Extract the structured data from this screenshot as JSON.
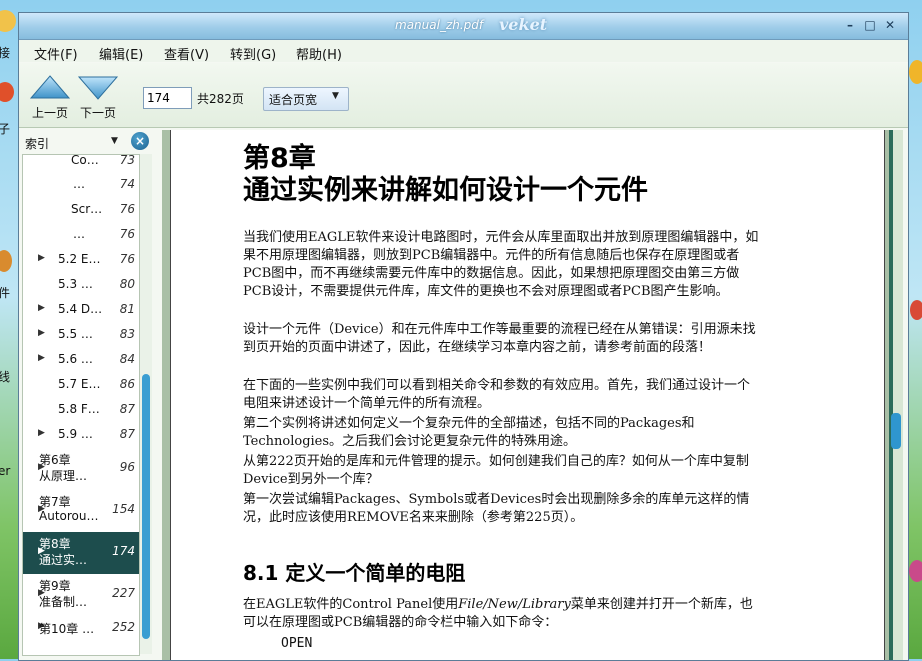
{
  "window": {
    "title": "manual_zh.pdf",
    "brand": "veket",
    "controls": [
      "–",
      "□",
      "✕"
    ]
  },
  "desktop": {
    "left_labels": [
      "接",
      "子",
      "件",
      "线",
      "er"
    ]
  },
  "menu": [
    {
      "label": "文件(F)"
    },
    {
      "label": "编辑(E)"
    },
    {
      "label": "查看(V)"
    },
    {
      "label": "转到(G)"
    },
    {
      "label": "帮助(H)"
    }
  ],
  "toolbar": {
    "prev_label": "上一页",
    "prev_icon": "triangle-up-icon",
    "next_label": "下一页",
    "next_icon": "triangle-down-icon",
    "page_value": "174",
    "total_label": "共282页",
    "zoom_value": "适合页宽"
  },
  "sidebar": {
    "mode": "索引",
    "close_icon": "close-icon",
    "items": [
      {
        "title": "Co…",
        "page": "73",
        "expander": false,
        "selected": false
      },
      {
        "title": "…",
        "page": "74",
        "expander": false,
        "selected": false
      },
      {
        "title": "Scr…",
        "page": "76",
        "expander": false,
        "selected": false
      },
      {
        "title": "…",
        "page": "76",
        "expander": false,
        "selected": false
      },
      {
        "title": "5.2 E…",
        "page": "76",
        "expander": true,
        "selected": false
      },
      {
        "title": "5.3 …",
        "page": "80",
        "expander": false,
        "selected": false
      },
      {
        "title": "5.4 D…",
        "page": "81",
        "expander": true,
        "selected": false
      },
      {
        "title": "5.5 …",
        "page": "83",
        "expander": true,
        "selected": false
      },
      {
        "title": "5.6 …",
        "page": "84",
        "expander": true,
        "selected": false
      },
      {
        "title": "5.7 E…",
        "page": "86",
        "expander": false,
        "selected": false
      },
      {
        "title": "5.8 F…",
        "page": "87",
        "expander": false,
        "selected": false
      },
      {
        "title": "5.9 …",
        "page": "87",
        "expander": true,
        "selected": false
      },
      {
        "title": "第6章",
        "title2": "从原理…",
        "page": "96",
        "expander": true,
        "selected": false
      },
      {
        "title": "第7章",
        "title2": "Autorou…",
        "page": "154",
        "expander": true,
        "selected": false
      },
      {
        "title": "第8章",
        "title2": "通过实…",
        "page": "174",
        "expander": true,
        "selected": true
      },
      {
        "title": "第9章",
        "title2": "准备制…",
        "page": "227",
        "expander": true,
        "selected": false
      },
      {
        "title": "第10章 …",
        "page": "252",
        "expander": true,
        "selected": false
      }
    ]
  },
  "document": {
    "chapter_number": "第8章",
    "chapter_title": "通过实例来讲解如何设计一个元件",
    "paragraphs": [
      "当我们使用EAGLE软件来设计电路图时，元件会从库里面取出并放到原理图编辑器中，如果不用原理图编辑器，则放到PCB编辑器中。元件的所有信息随后也保存在原理图或者PCB图中，而不再继续需要元件库中的数据信息。因此，如果想把原理图交由第三方做PCB设计，不需要提供元件库，库文件的更换也不会对原理图或者PCB图产生影响。",
      "设计一个元件（Device）和在元件库中工作等最重要的流程已经在从第错误：引用源未找到页开始的页面中讲述了，因此，在继续学习本章内容之前，请参考前面的段落！",
      "在下面的一些实例中我们可以看到相关命令和参数的有效应用。首先，我们通过设计一个电阻来讲述设计一个简单元件的所有流程。",
      "第二个实例将讲述如何定义一个复杂元件的全部描述，包括不同的Packages和Technologies。之后我们会讨论更复杂元件的特殊用途。",
      "从第222页开始的是库和元件管理的提示。如何创建我们自己的库？如何从一个库中复制Device到另外一个库？",
      "第一次尝试编辑Packages、Symbols或者Devices时会出现删除多余的库单元这样的情况，此时应该使用REMOVE名来来删除（参考第225页）。"
    ],
    "section_title": "8.1  定义一个简单的电阻",
    "section_para_before": "在EAGLE软件的Control Panel使用",
    "section_para_italic": "File/New/Library",
    "section_para_after": "菜单来创建并打开一个新库，也可以在原理图或PCB编辑器的命令栏中输入如下命令：",
    "code_line": "OPEN"
  }
}
